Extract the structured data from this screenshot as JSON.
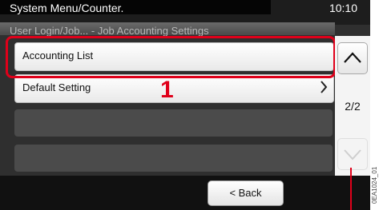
{
  "header": {
    "title": "System Menu/Counter.",
    "time": "10:10",
    "breadcrumb": "User Login/Job... - Job Accounting Settings"
  },
  "list": {
    "items": [
      {
        "label": "Accounting List",
        "has_chevron": false
      },
      {
        "label": "Default Setting",
        "has_chevron": true
      }
    ]
  },
  "callout": "1",
  "pager": {
    "indicator": "2/2"
  },
  "footer": {
    "back_label": "< Back"
  },
  "side_code": "0EA1024_01",
  "colors": {
    "highlight": "#e0001a",
    "header_bg": "#1d1d1d",
    "body_bg": "#2f2f2f"
  },
  "icons": {
    "up": "chevron-up-icon",
    "down": "chevron-down-icon",
    "row": "chevron-right-icon"
  }
}
